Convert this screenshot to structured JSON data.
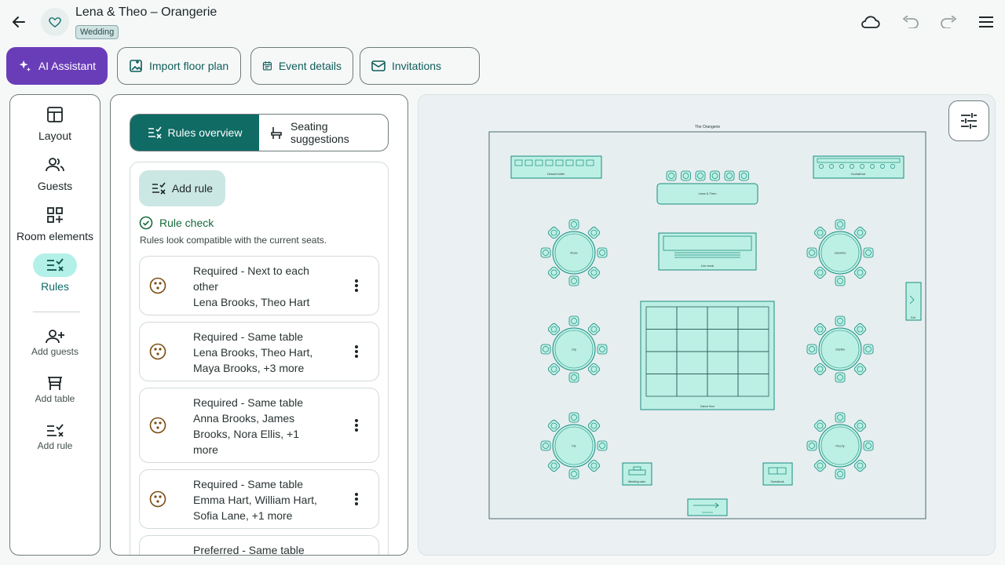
{
  "header": {
    "title": "Lena & Theo – Orangerie",
    "tag": "Wedding",
    "icons": [
      "back-arrow-icon",
      "heart-icon",
      "cloud-icon",
      "undo-icon",
      "redo-icon",
      "menu-icon"
    ]
  },
  "toolbar": {
    "ai_assistant": "AI Assistant",
    "import_floor_plan": "Import floor plan",
    "event_details": "Event details",
    "invitations": "Invitations",
    "ai_color": "#6a3db8"
  },
  "nav": {
    "items": [
      {
        "label": "Layout",
        "icon": "layout-icon"
      },
      {
        "label": "Guests",
        "icon": "guests-icon"
      },
      {
        "label": "Room elements",
        "icon": "room-elements-icon"
      },
      {
        "label": "Rules",
        "icon": "rules-icon",
        "active": true
      }
    ],
    "actions": [
      {
        "label": "Add guests",
        "icon": "add-guest-icon"
      },
      {
        "label": "Add table",
        "icon": "table-icon"
      },
      {
        "label": "Add rule",
        "icon": "rule-icon"
      }
    ]
  },
  "rules_panel": {
    "tab_overview": "Rules overview",
    "tab_suggestions": "Seating suggestions",
    "add_rule": "Add rule",
    "check_title": "Rule check",
    "check_subtitle": "Rules look compatible with the current seats.",
    "rules": [
      {
        "type": "Required - Next to each other",
        "people": "Lena Brooks, Theo Hart"
      },
      {
        "type": "Required - Same table",
        "people": "Lena Brooks, Theo Hart, Maya Brooks, +3 more"
      },
      {
        "type": "Required - Same table",
        "people": "Anna Brooks, James Brooks, Nora Ellis, +1 more"
      },
      {
        "type": "Required - Same table",
        "people": "Emma Hart, William Hart, Sofia Lane, +1 more"
      },
      {
        "type": "Preferred - Same table",
        "people": ""
      }
    ]
  },
  "floor_plan": {
    "room_name": "The Orangerie",
    "elements": {
      "dessert_buffet": "Dessert buffet",
      "head_table": "Lena & Theo",
      "cocktail_bar": "Cocktail bar",
      "live_music": "Live music",
      "dance_floor": "Dance floor",
      "exit": "Exit",
      "wedding_cake": "Wedding cake",
      "guestbook": "Guestbook"
    },
    "round_tables": [
      "Rose",
      "Jasmine",
      "Lily",
      "Dahlia",
      "Iris",
      "Peony"
    ],
    "accent_color": "#1a8c80",
    "table_fill": "#bdf0e4"
  }
}
